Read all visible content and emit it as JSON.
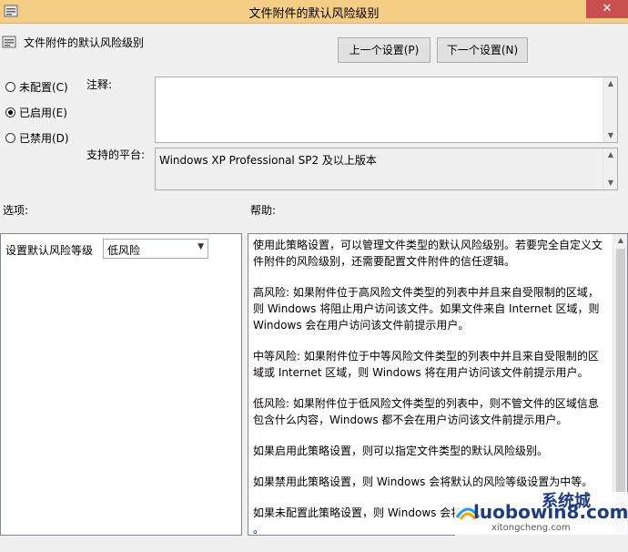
{
  "window": {
    "title": "文件附件的默认风险级别",
    "close_glyph": "✕"
  },
  "header": {
    "policy_name": "文件附件的默认风险级别",
    "prev_button": "上一个设置(P)",
    "next_button": "下一个设置(N)"
  },
  "state": {
    "options": [
      {
        "label": "未配置(C)",
        "checked": false
      },
      {
        "label": "已启用(E)",
        "checked": true
      },
      {
        "label": "已禁用(D)",
        "checked": false
      }
    ]
  },
  "comment": {
    "label": "注释:",
    "value": ""
  },
  "platform": {
    "label": "支持的平台:",
    "value": "Windows XP Professional SP2 及以上版本"
  },
  "options_section": {
    "label": "选项:",
    "risk_label": "设置默认风险等级",
    "risk_value": "低风险"
  },
  "help_section": {
    "label": "帮助:",
    "paragraphs": [
      "使用此策略设置，可以管理文件类型的默认风险级别。若要完全自定义文件附件的风险级别，还需要配置文件附件的信任逻辑。",
      "高风险: 如果附件位于高风险文件类型的列表中并且来自受限制的区域，则 Windows 将阻止用户访问该文件。如果文件来自 Internet 区域，则 Windows 会在用户访问该文件前提示用户。",
      "中等风险: 如果附件位于中等风险文件类型的列表中并且来自受限制的区域或 Internet 区域，则 Windows 将在用户访问该文件前提示用户。",
      "低风险: 如果附件位于低风险文件类型的列表中，则不管文件的区域信息包含什么内容，Windows 都不会在用户访问该文件前提示用户。",
      "如果启用此策略设置，则可以指定文件类型的默认风险级别。",
      "如果禁用此策略设置，则 Windows 会将默认的风险等级设置为中等。",
      "如果未配置此策略设置，则 Windows 会将",
      "。"
    ]
  },
  "watermark": {
    "main": "luobowin8.com",
    "sub": "xitongcheng.com",
    "overlay": "系统城"
  }
}
